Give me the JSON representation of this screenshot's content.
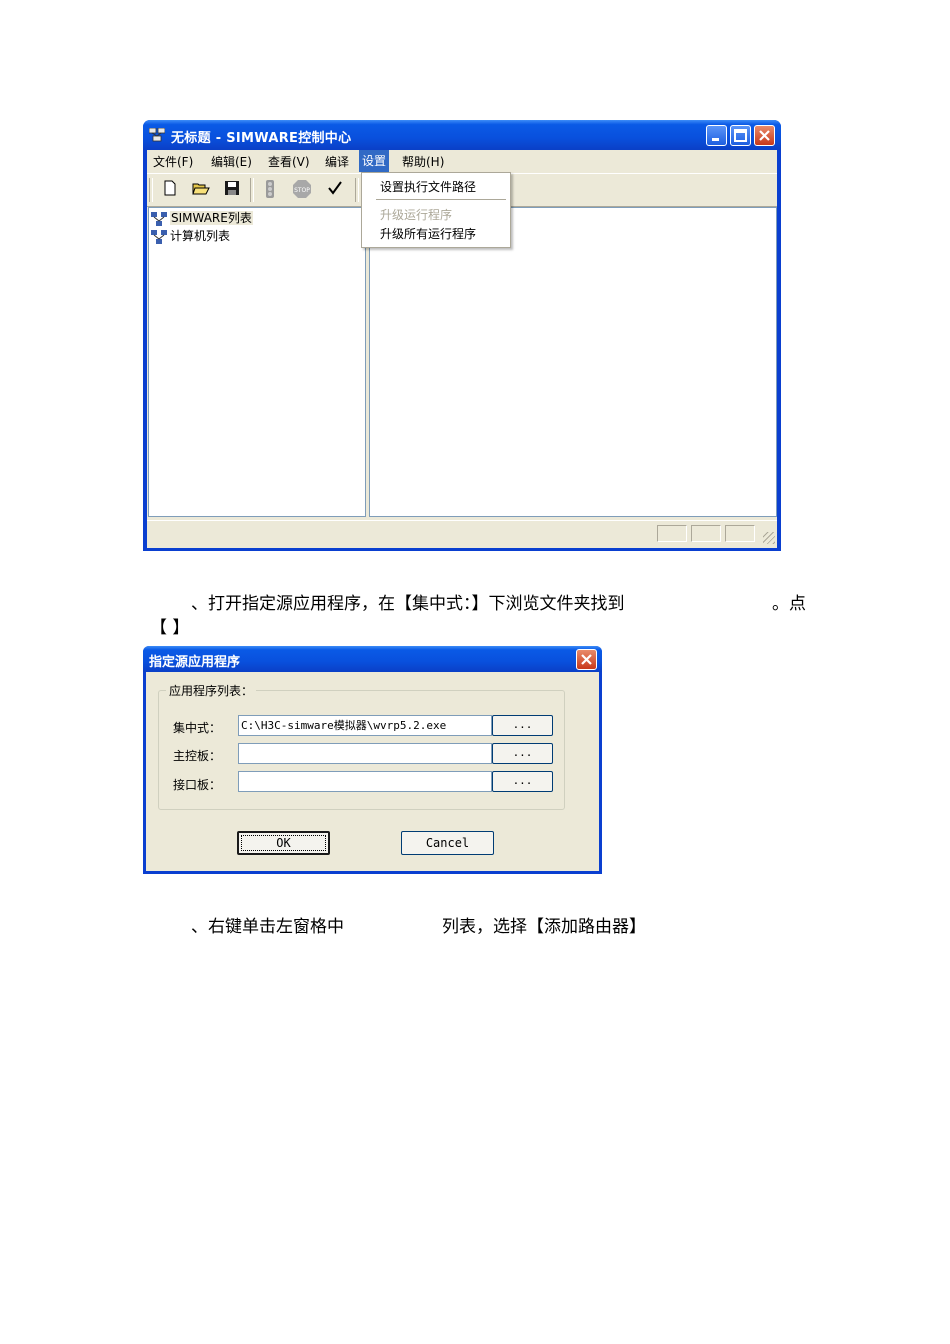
{
  "window": {
    "title": "无标题 - SIMWARE控制中心",
    "menu": [
      "文件(F)",
      "编辑(E)",
      "查看(V)",
      "编译",
      "设置",
      "帮助(H)"
    ],
    "active_menu_index": 4,
    "dropdown": {
      "items": [
        {
          "label": "设置执行文件路径",
          "enabled": true
        },
        {
          "label": "升级运行程序",
          "enabled": false
        },
        {
          "label": "升级所有运行程序",
          "enabled": true
        }
      ]
    },
    "toolbar_icons": [
      "new-file-icon",
      "open-folder-icon",
      "save-icon",
      "traffic-light-icon",
      "stop-icon",
      "check-icon"
    ],
    "tree": [
      {
        "label": "SIMWARE列表",
        "selected": true
      },
      {
        "label": "计算机列表",
        "selected": false
      }
    ]
  },
  "paragraph1": {
    "line1": "、打开指定源应用程序，在【集中式：】下浏览文件夹找到",
    "line1_end": "。点",
    "line2": "【    】"
  },
  "dialog": {
    "title": "指定源应用程序",
    "group_label": "应用程序列表：",
    "fields": [
      {
        "label": "集中式：",
        "value": "C:\\H3C-simware模拟器\\wvrp5.2.exe",
        "browse": "..."
      },
      {
        "label": "主控板：",
        "value": "",
        "browse": "..."
      },
      {
        "label": "接口板：",
        "value": "",
        "browse": "..."
      }
    ],
    "ok_label": "OK",
    "cancel_label": "Cancel"
  },
  "paragraph2": {
    "part1": "、右键单击左窗格中",
    "part2": "列表，选择【添加路由器】"
  }
}
